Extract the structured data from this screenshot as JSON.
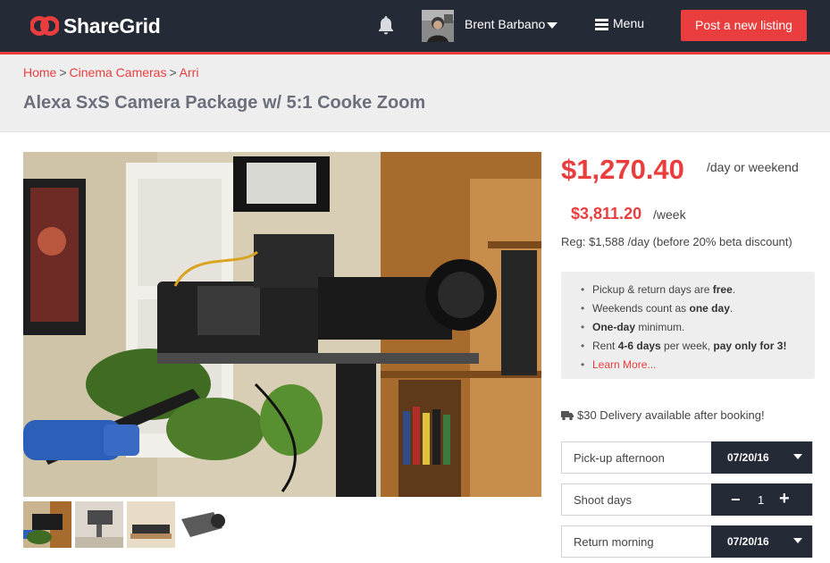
{
  "header": {
    "brand": "ShareGrid",
    "user_name": "Brent Barbano",
    "menu_label": "Menu",
    "post_button": "Post a new listing",
    "accent_color": "#ea3e3e",
    "bar_color": "#252a37"
  },
  "breadcrumb": {
    "items": [
      "Home",
      "Cinema Cameras",
      "Arri"
    ],
    "separator": ">"
  },
  "listing": {
    "title": "Alexa SxS Camera Package w/ 5:1 Cooke Zoom"
  },
  "pricing": {
    "day_price": "$1,270.40",
    "day_unit": "/day or weekend",
    "week_price": "$3,811.20",
    "week_unit": "/week",
    "regular": "Reg: $1,588 /day (before 20% beta discount)"
  },
  "info": {
    "l1_a": "Pickup & return days are ",
    "l1_b": "free",
    "l1_c": ".",
    "l2_a": "Weekends count as ",
    "l2_b": "one day",
    "l2_c": ".",
    "l3_a": "One-day",
    "l3_b": " minimum.",
    "l4_a": "Rent ",
    "l4_b": "4-6 days",
    "l4_c": " per week, ",
    "l4_d": "pay only for 3!",
    "learn_more": "Learn More..."
  },
  "delivery": {
    "icon": "truck-icon",
    "text": "$30 Delivery available after booking!"
  },
  "booking": {
    "pickup_label": "Pick-up afternoon",
    "pickup_date": "07/20/16",
    "shoot_label": "Shoot days",
    "minus": "−",
    "shoot_days": "1",
    "plus": "+",
    "return_label": "Return morning",
    "return_date": "07/20/16"
  }
}
